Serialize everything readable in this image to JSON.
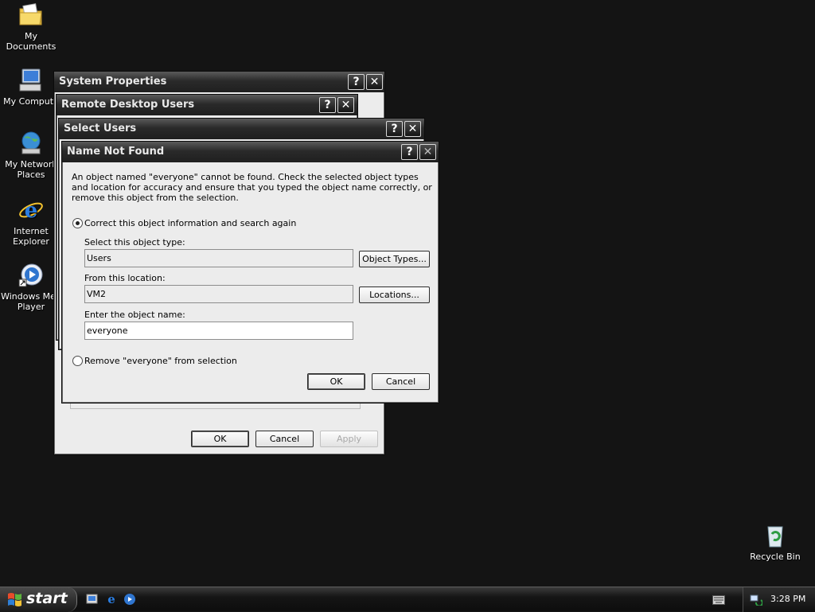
{
  "desktop": {
    "icons": [
      {
        "label": "My Documents"
      },
      {
        "label": "My Compute"
      },
      {
        "label": "My Network\nPlaces"
      },
      {
        "label": "Internet\nExplorer"
      },
      {
        "label": "Windows Med\nPlayer"
      },
      {
        "label": "Recycle Bin"
      }
    ]
  },
  "system_properties": {
    "title": "System Properties",
    "ok_label": "OK",
    "cancel_label": "Cancel",
    "apply_label": "Apply"
  },
  "remote_desktop_users": {
    "title": "Remote Desktop Users"
  },
  "select_users": {
    "title": "Select Users"
  },
  "name_not_found": {
    "title": "Name Not Found",
    "message": "An object named \"everyone\" cannot be found. Check the selected object types and location for accuracy and ensure that you typed the object name correctly, or remove this object from the selection.",
    "option_correct_label": "Correct this object information and search again",
    "object_type_label": "Select this object type:",
    "object_type_value": "Users",
    "object_types_button": "Object Types...",
    "location_label": "From this location:",
    "location_value": "VM2",
    "locations_button": "Locations...",
    "object_name_label": "Enter the object name:",
    "object_name_value": "everyone",
    "option_remove_label": "Remove \"everyone\" from selection",
    "ok_label": "OK",
    "cancel_label": "Cancel",
    "selected_option": "correct"
  },
  "taskbar": {
    "start_label": "start",
    "clock": "3:28 PM"
  },
  "colors": {
    "desktop_bg": "#141414",
    "titlebar": "#2a2a2a",
    "dialog_bg": "#ececec"
  }
}
